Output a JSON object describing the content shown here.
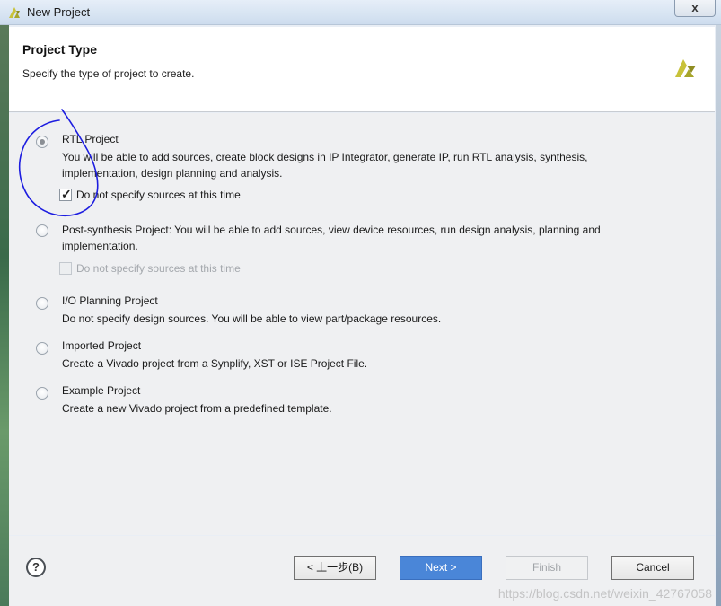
{
  "window": {
    "title": "New Project",
    "close_label": "x"
  },
  "header": {
    "title": "Project Type",
    "subtitle": "Specify the type of project to create."
  },
  "options": [
    {
      "title": "RTL Project",
      "description": "You will be able to add sources, create block designs in IP Integrator, generate IP, run RTL analysis, synthesis, implementation, design planning and analysis.",
      "selected": true,
      "checkbox": {
        "label": "Do not specify sources at this time",
        "checked": true,
        "enabled": true
      }
    },
    {
      "title": "Post-synthesis Project:",
      "description": "You will be able to add sources, view device resources, run design analysis, planning and implementation.",
      "selected": false,
      "checkbox": {
        "label": "Do not specify sources at this time",
        "checked": false,
        "enabled": false
      }
    },
    {
      "title": "I/O Planning Project",
      "description": "Do not specify design sources. You will be able to view part/package resources.",
      "selected": false
    },
    {
      "title": "Imported Project",
      "description": "Create a Vivado project from a Synplify, XST or ISE Project File.",
      "selected": false
    },
    {
      "title": "Example Project",
      "description": "Create a new Vivado project from a predefined template.",
      "selected": false
    }
  ],
  "footer": {
    "help_label": "?",
    "back_label": "< 上一步(B)",
    "next_label": "Next >",
    "finish_label": "Finish",
    "cancel_label": "Cancel"
  },
  "watermark": "https://blog.csdn.net/weixin_42767058",
  "colors": {
    "primary_button": "#4a86d8",
    "annotation": "#1d1de0",
    "logo": "#c8c23a"
  },
  "icons": {
    "window_logo": "vivado-logo-icon",
    "header_logo": "vivado-logo-icon",
    "help": "help-icon",
    "check": "checkmark-icon"
  }
}
